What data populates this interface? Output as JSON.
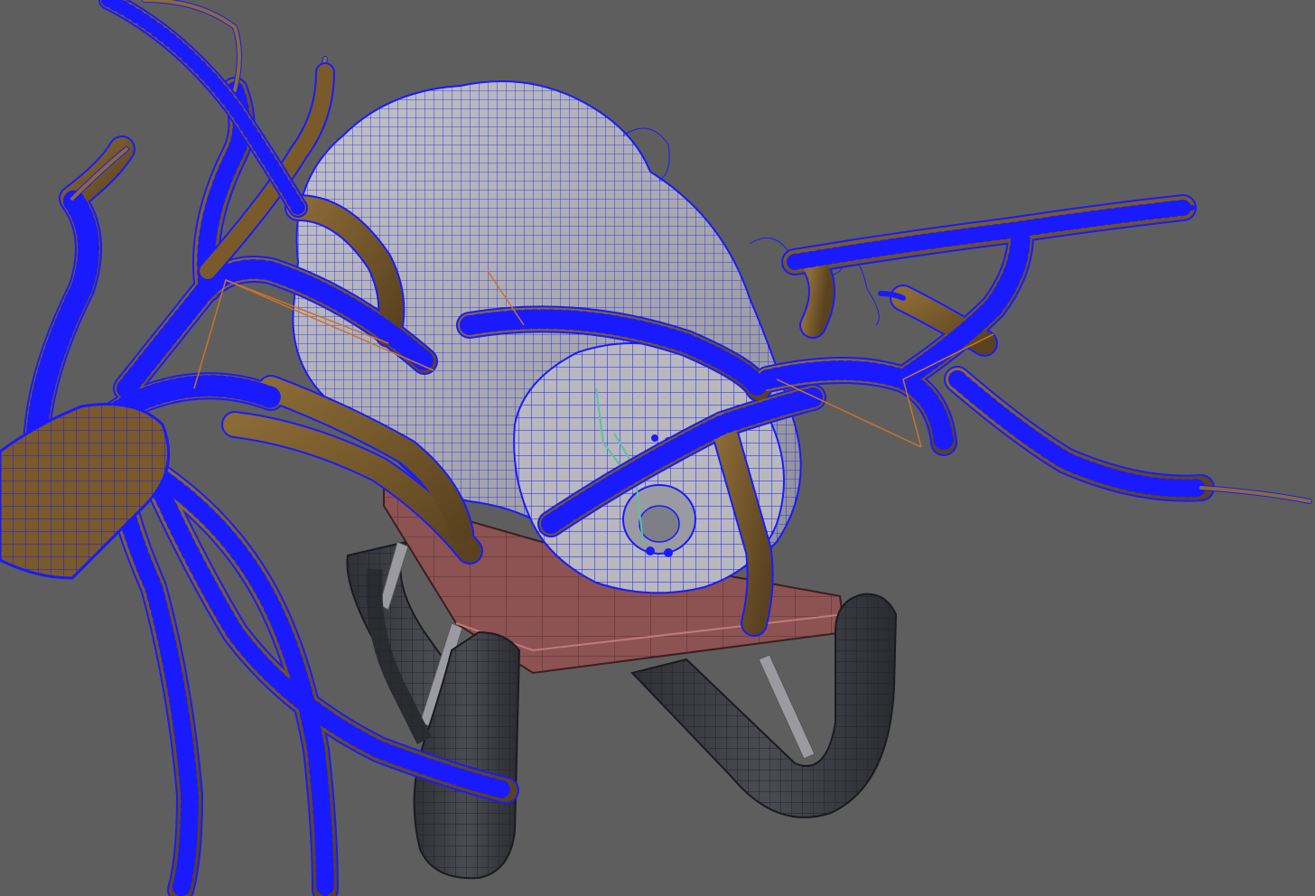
{
  "viewport": {
    "background": "#5e5e5e",
    "wire_color": "#1a1aff",
    "branch_color": "#7a5a2a",
    "branch_dark": "#4f3a1a",
    "sheep_color": "#a9a9b0",
    "sled_seat_color": "#8a5050",
    "sled_runner_color": "#3b3d42",
    "bone_orange": "#c8732a",
    "bone_green": "#5fc0a0"
  },
  "scene": {
    "objects": [
      "sheep-mesh",
      "tree-branches-mesh",
      "sled-mesh",
      "face-rig-joints"
    ]
  }
}
